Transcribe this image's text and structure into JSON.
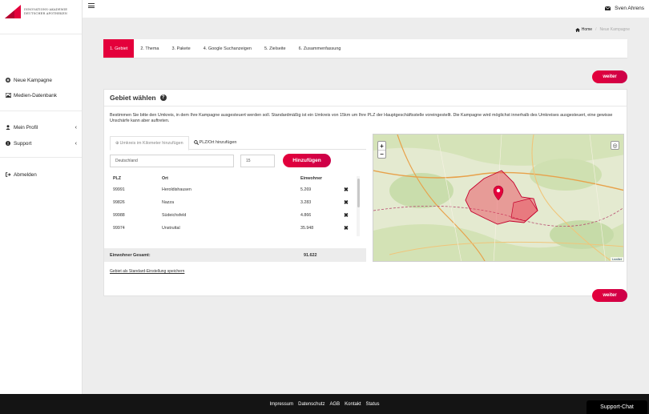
{
  "logo": {
    "line1": "INNOVATIONS-AKADEMIE",
    "line2": "DEUTSCHER APOTHEKEN"
  },
  "sidebar": {
    "items": [
      {
        "label": "Neue Kampagne",
        "icon": "plus-circle-icon"
      },
      {
        "label": "Medien-Datenbank",
        "icon": "image-icon"
      },
      {
        "label": "Mein Profil",
        "icon": "user-icon",
        "chevron": "‹"
      },
      {
        "label": "Support",
        "icon": "info-icon",
        "chevron": "‹"
      },
      {
        "label": "Abmelden",
        "icon": "logout-icon"
      }
    ]
  },
  "topbar": {
    "user": "Sven Ahrens"
  },
  "breadcrumb": {
    "home": "Home",
    "separator": "/",
    "current": "Neue Kampagne"
  },
  "steps": [
    {
      "label": "1. Gebiet",
      "active": true
    },
    {
      "label": "2. Thema"
    },
    {
      "label": "3. Pakete"
    },
    {
      "label": "4. Google Suchanzeigen"
    },
    {
      "label": "5. Zielseite"
    },
    {
      "label": "6. Zusammenfassung"
    }
  ],
  "buttons": {
    "weiter": "weiter",
    "add": "Hinzufügen"
  },
  "panel": {
    "title": "Gebiet wählen",
    "intro": "Bestimmen Sie bitte den Umkreis, in dem Ihre Kampagne ausgesteuert werden soll. Standardmäßig ist ein Umkreis von 15km um Ihre PLZ der Hauptgeschäftsstelle voreingestellt. Die Kampagne wird möglichst innerhalb des Umkreises ausgesteuert, eine gewisse Unschärfe kann aber auftreten.",
    "tabs": [
      "Umkreis im Kilometer hinzufügen",
      "PLZ/Ort hinzufügen"
    ],
    "location_value": "Deutschland",
    "radius_value": "15"
  },
  "table": {
    "headers": {
      "plz": "PLZ",
      "ort": "Ort",
      "einwohner": "Einwohner"
    },
    "rows": [
      {
        "plz": "99991",
        "ort": "Heroldishausen",
        "einwohner": "5.269"
      },
      {
        "plz": "99826",
        "ort": "Nazza",
        "einwohner": "3.283"
      },
      {
        "plz": "99988",
        "ort": "Südeichsfeld",
        "einwohner": "4.866"
      },
      {
        "plz": "99974",
        "ort": "Unstruttal",
        "einwohner": "35.948"
      }
    ],
    "total_label": "Einwohner Gesamt:",
    "total_value": "91.622"
  },
  "save_link": "Gebiet als Standard-Einstellung speichern",
  "map": {
    "attribution": "Leaflet"
  },
  "footer": {
    "links": [
      "Impressum",
      "Datenschutz",
      "AGB",
      "Kontakt",
      "Status"
    ]
  },
  "support_chat": "Support-Chat",
  "colors": {
    "accent": "#e4003b",
    "footer": "#141414"
  }
}
